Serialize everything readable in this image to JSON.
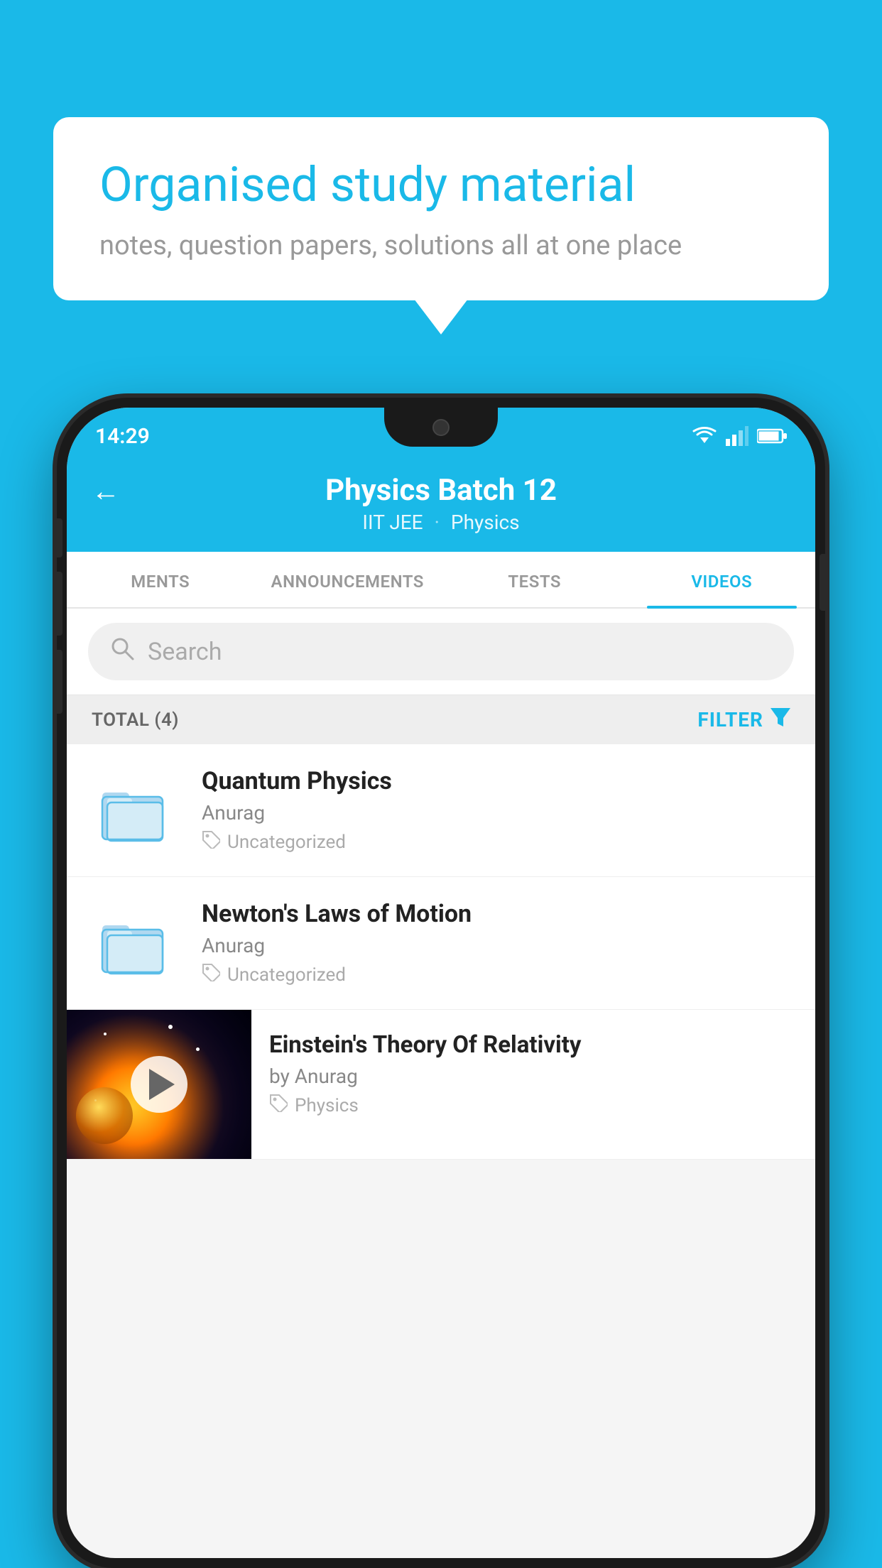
{
  "background": {
    "color": "#1ab9e8"
  },
  "speech_bubble": {
    "title": "Organised study material",
    "subtitle": "notes, question papers, solutions all at one place"
  },
  "status_bar": {
    "time": "14:29",
    "wifi_icon": "wifi",
    "signal_icon": "signal",
    "battery_icon": "battery"
  },
  "header": {
    "back_label": "←",
    "title": "Physics Batch 12",
    "tag1": "IIT JEE",
    "separator": " ",
    "tag2": "Physics"
  },
  "tabs": [
    {
      "label": "MENTS",
      "active": false
    },
    {
      "label": "ANNOUNCEMENTS",
      "active": false
    },
    {
      "label": "TESTS",
      "active": false
    },
    {
      "label": "VIDEOS",
      "active": true
    }
  ],
  "search": {
    "placeholder": "Search"
  },
  "filter_bar": {
    "total_label": "TOTAL (4)",
    "filter_label": "FILTER"
  },
  "videos": [
    {
      "title": "Quantum Physics",
      "author": "Anurag",
      "tag": "Uncategorized",
      "has_thumbnail": false
    },
    {
      "title": "Newton's Laws of Motion",
      "author": "Anurag",
      "tag": "Uncategorized",
      "has_thumbnail": false
    },
    {
      "title": "Einstein's Theory Of Relativity",
      "author": "by Anurag",
      "tag": "Physics",
      "has_thumbnail": true
    }
  ]
}
